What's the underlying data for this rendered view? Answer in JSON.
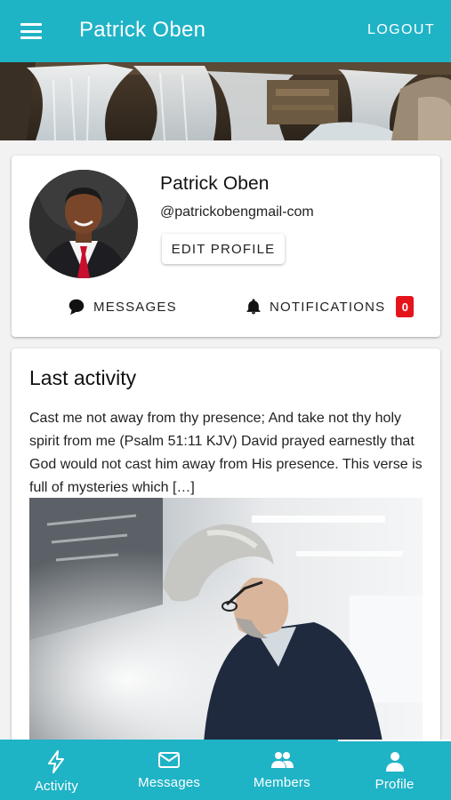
{
  "app_bar": {
    "title": "Patrick Oben",
    "logout_label": "LOGOUT",
    "menu_icon": "menu-icon"
  },
  "profile": {
    "name": "Patrick Oben",
    "handle": "@patrickobengmail-com",
    "edit_label": "EDIT PROFILE",
    "messages_label": "MESSAGES",
    "notifications_label": "NOTIFICATIONS",
    "notifications_count": "0"
  },
  "activity": {
    "title": "Last activity",
    "text": "Cast me not away from thy presence; And take not thy holy spirit from me (Psalm 51:11 KJV) David prayed earnestly that God would not cast him away from His presence. This verse is full of mysteries which […]"
  },
  "bottom_nav": {
    "items": [
      {
        "label": "Activity",
        "icon": "lightning-icon"
      },
      {
        "label": "Messages",
        "icon": "envelope-icon"
      },
      {
        "label": "Members",
        "icon": "group-icon"
      },
      {
        "label": "Profile",
        "icon": "person-icon",
        "active": true
      }
    ]
  },
  "colors": {
    "primary": "#1fb3c6",
    "badge": "#e5141b",
    "background": "#f2f2f2"
  }
}
